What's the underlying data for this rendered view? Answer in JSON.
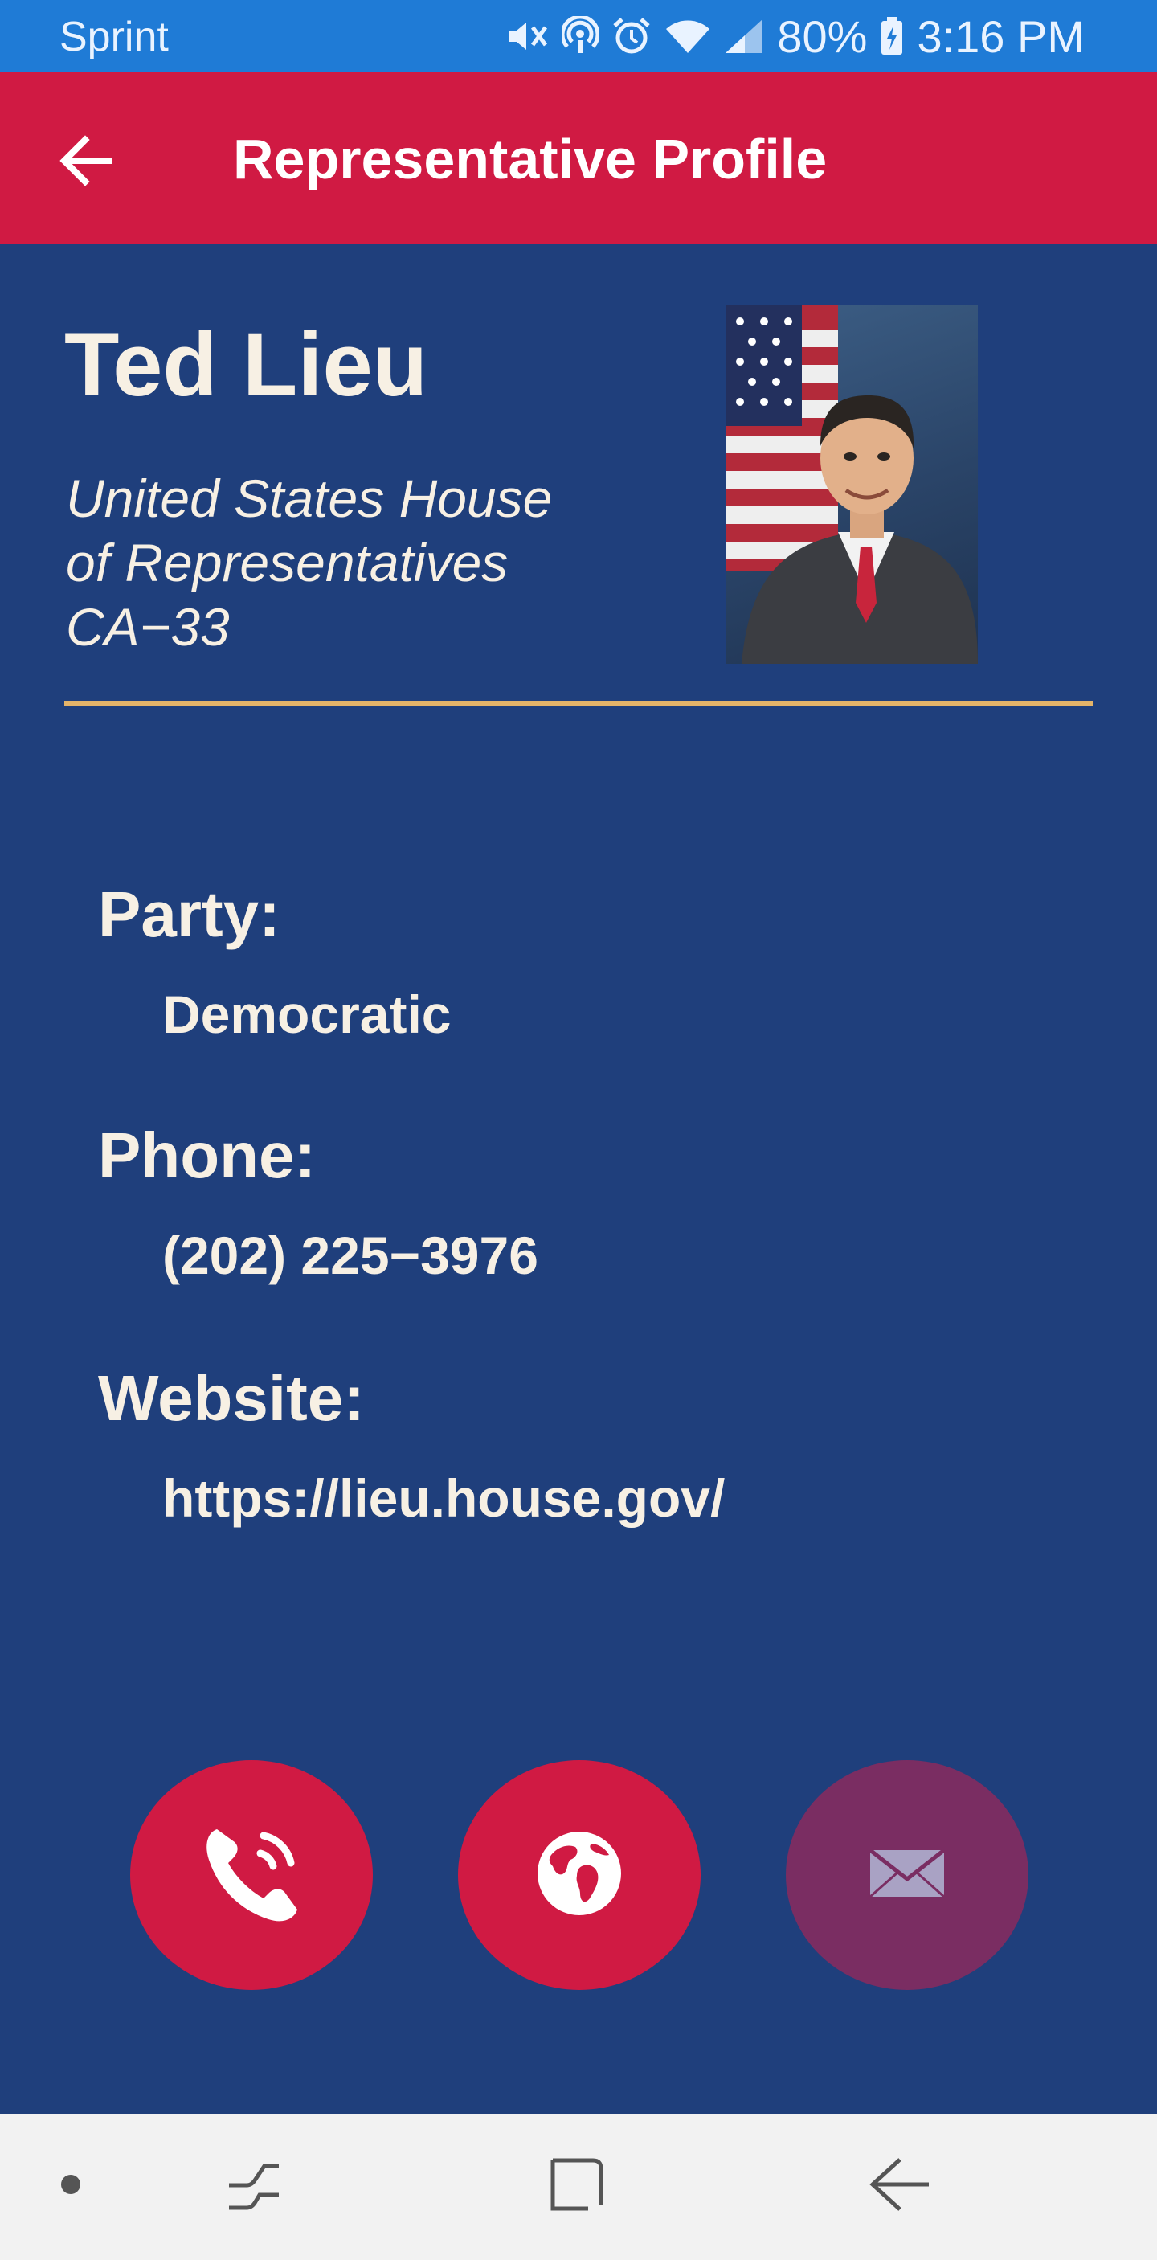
{
  "status_bar": {
    "carrier": "Sprint",
    "battery": "80%",
    "time": "3:16 PM",
    "icons": [
      "mute-icon",
      "hotspot-icon",
      "alarm-icon",
      "wifi-icon",
      "signal-icon",
      "battery-charging-icon"
    ]
  },
  "app_bar": {
    "title": "Representative Profile",
    "back_icon": "arrow-left-icon",
    "color": "#d01a43"
  },
  "profile": {
    "name": "Ted Lieu",
    "office_lines": [
      "United States House",
      "of Representatives",
      "CA−33"
    ],
    "photo": "representative-portrait"
  },
  "fields": {
    "party_label": "Party:",
    "party_value": "Democratic",
    "phone_label": "Phone:",
    "phone_value": "(202) 225−3976",
    "website_label": "Website:",
    "website_value": "https://lieu.house.gov/"
  },
  "actions": [
    {
      "icon": "phone-icon",
      "color": "#d01a43"
    },
    {
      "icon": "globe-icon",
      "color": "#d01a43"
    },
    {
      "icon": "mail-icon",
      "color": "#7a2d62"
    }
  ],
  "nav_bar": {
    "items": [
      "dot-icon",
      "recent-apps-icon",
      "home-icon",
      "back-nav-icon"
    ]
  },
  "colors": {
    "background": "#1f3f7c",
    "status_bar": "#1f7bd6",
    "accent_divider": "#e4b469",
    "text": "#f7f0e4"
  }
}
